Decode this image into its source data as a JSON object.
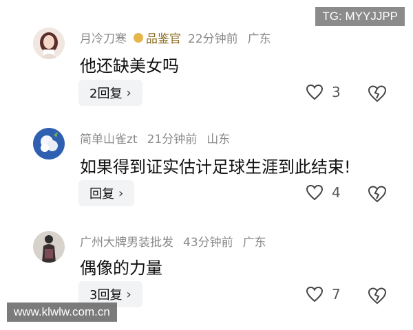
{
  "watermarks": {
    "tg": "TG: MYYJJPP",
    "site": "www.klwlw.com.cn"
  },
  "colors": {
    "meta_gray": "#8a8a8a",
    "badge_gold": "#e4b64b",
    "reply_bg": "#f2f3f5"
  },
  "comments": [
    {
      "username": "月冷刀寒",
      "badge": "品鉴官",
      "time": "22分钟前",
      "location": "广东",
      "text": "他还缺美女吗",
      "reply_label": "2回复",
      "likes": "3",
      "avatar_icon": "avatar-woman-icon"
    },
    {
      "username": "简单山雀zt",
      "time": "21分钟前",
      "location": "山东",
      "text": "如果得到证实估计足球生涯到此结束!",
      "reply_label": "回复",
      "likes": "4",
      "avatar_icon": "avatar-flower-icon"
    },
    {
      "username": "广州大牌男装批发",
      "time": "43分钟前",
      "location": "广东",
      "text": "偶像的力量",
      "reply_label": "3回复",
      "likes": "7",
      "avatar_icon": "avatar-mannequin-icon"
    }
  ]
}
